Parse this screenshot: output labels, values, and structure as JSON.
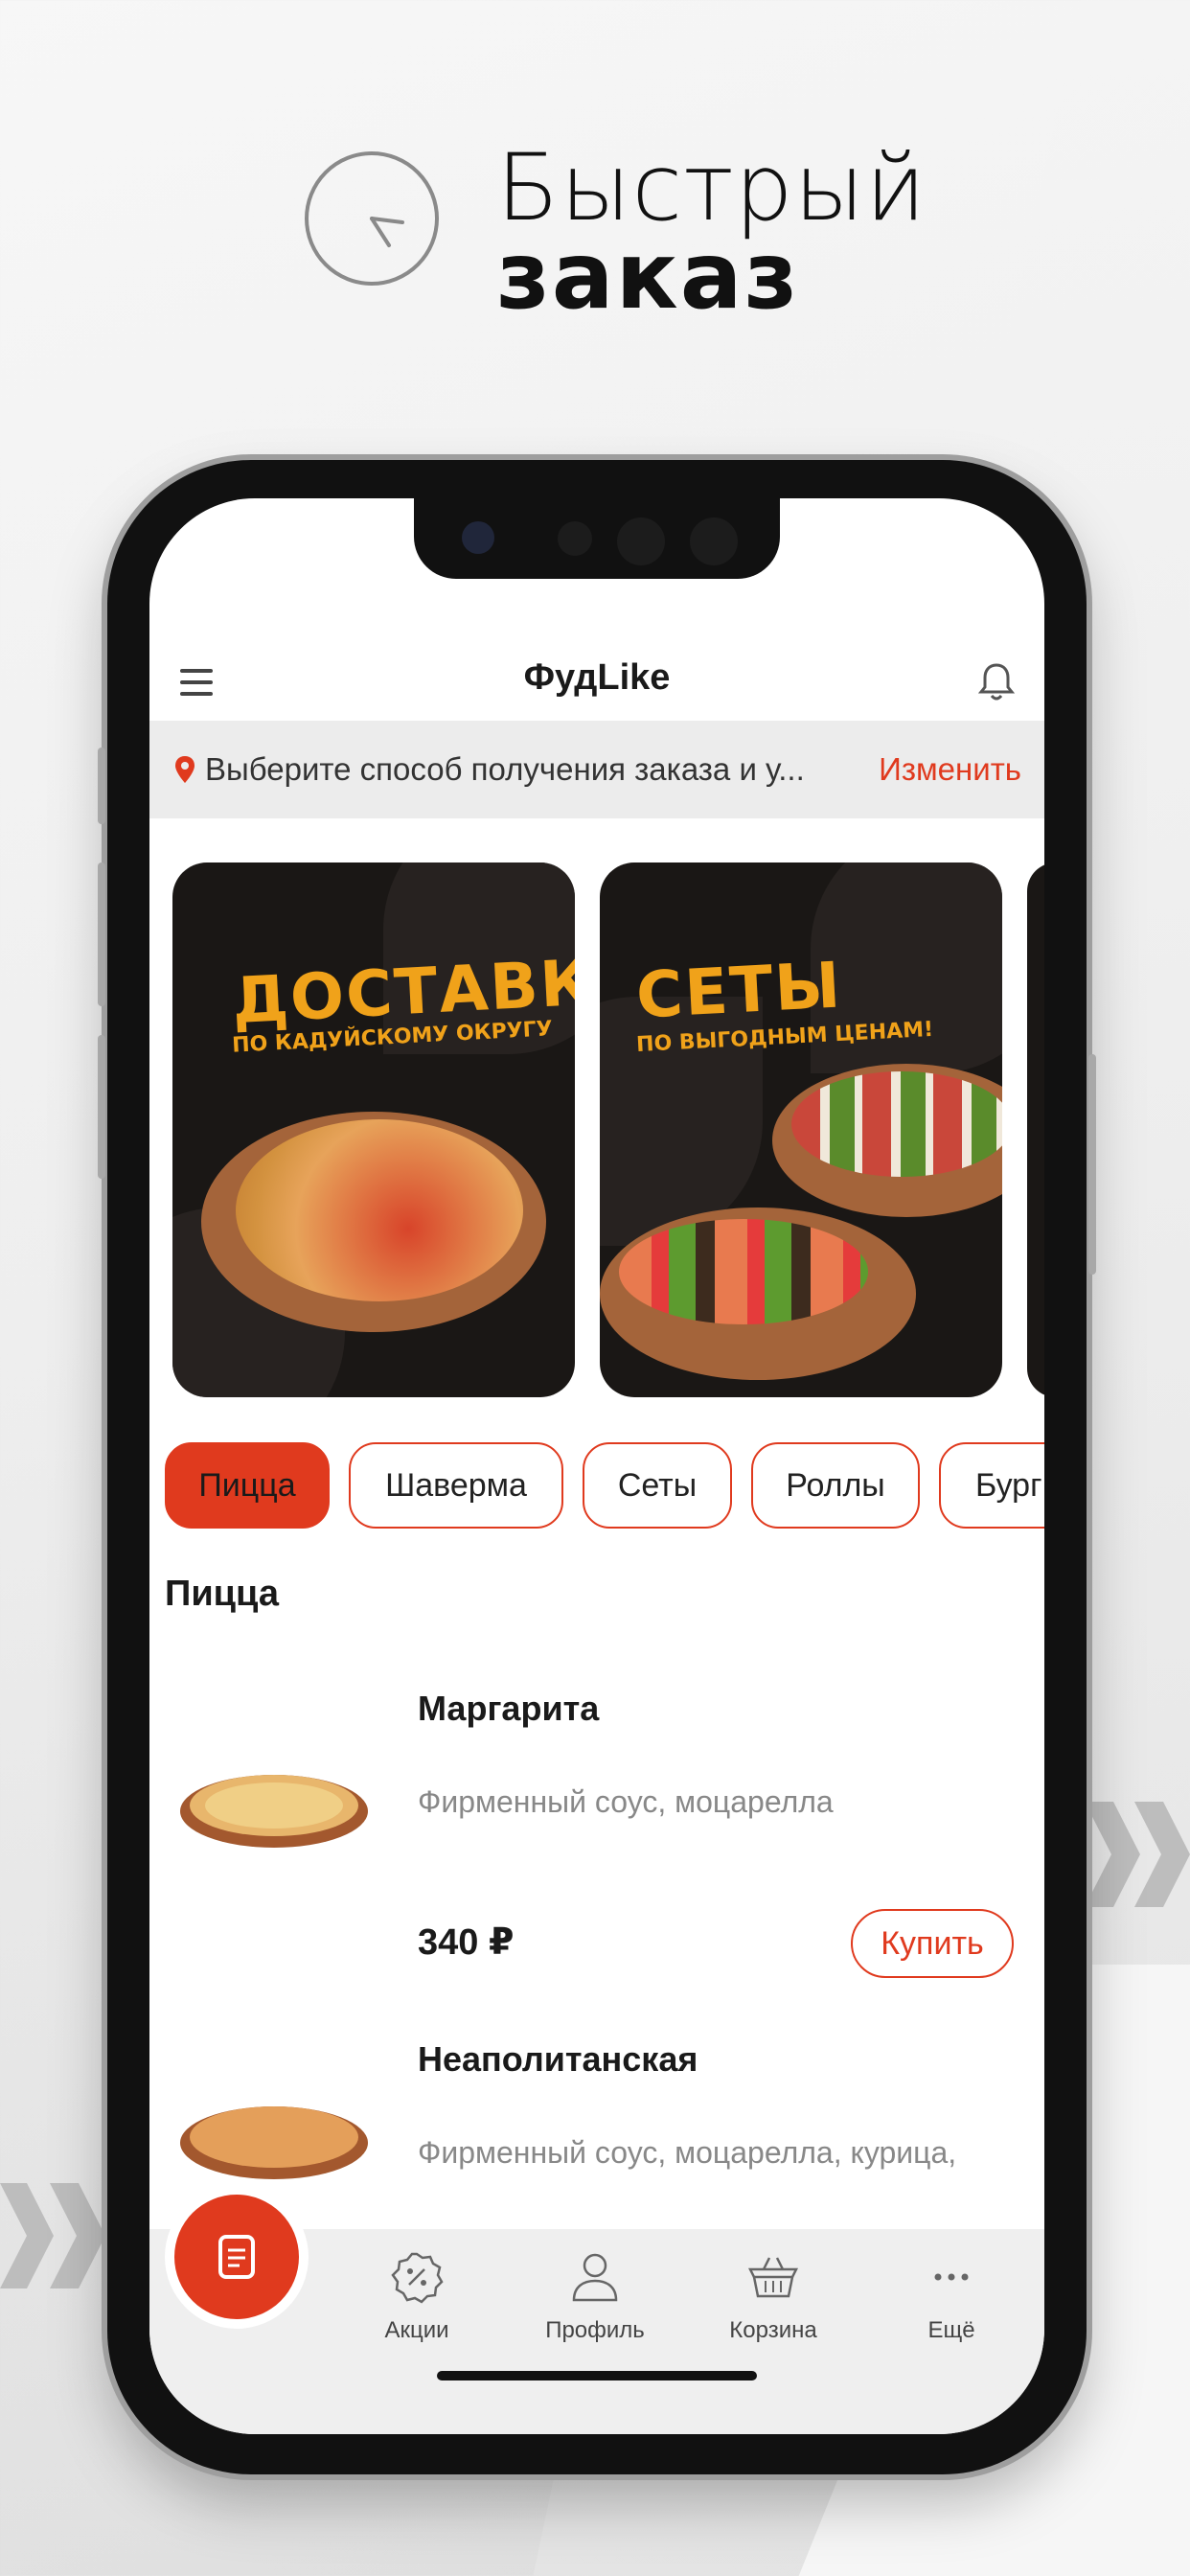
{
  "promo": {
    "title_line1": "Быстрый",
    "title_line2": "заказ"
  },
  "app": {
    "title": "ФудLike"
  },
  "location": {
    "text": "Выберите способ получения заказа и у...",
    "change_label": "Изменить"
  },
  "banners": [
    {
      "title": "ДОСТАВКА",
      "subtitle": "ПО КАДУЙСКОМУ ОКРУГУ"
    },
    {
      "title": "СЕТЫ",
      "subtitle": "ПО ВЫГОДНЫМ ЦЕНАМ!"
    }
  ],
  "categories": [
    {
      "label": "Пицца",
      "active": true
    },
    {
      "label": "Шаверма"
    },
    {
      "label": "Сеты"
    },
    {
      "label": "Роллы"
    },
    {
      "label": "Бург"
    }
  ],
  "section": {
    "title": "Пицца"
  },
  "products": [
    {
      "name": "Маргарита",
      "description": "Фирменный соус, моцарелла",
      "price": "340 ₽",
      "buy_label": "Купить"
    },
    {
      "name": "Неаполитанская",
      "description": "Фирменный соус, моцарелла, курица,"
    }
  ],
  "nav": {
    "items": [
      {
        "label": "Акции",
        "icon": "discount-icon"
      },
      {
        "label": "Профиль",
        "icon": "user-icon"
      },
      {
        "label": "Корзина",
        "icon": "basket-icon"
      },
      {
        "label": "Ещё",
        "icon": "more-icon"
      }
    ]
  },
  "colors": {
    "accent": "#e03a1e",
    "banner_bg": "#1a1715",
    "banner_text": "#f0a21a",
    "location_bg": "#ececec"
  }
}
